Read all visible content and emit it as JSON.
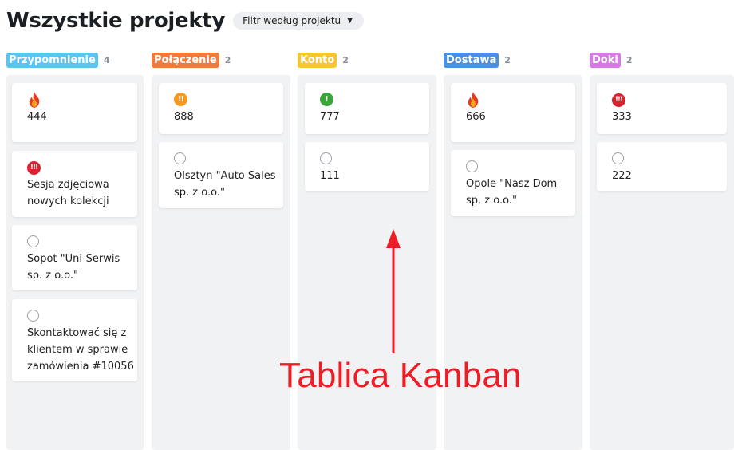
{
  "header": {
    "title": "Wszystkie projekty",
    "filter_label": "Filtr według projektu",
    "filter_caret": "▼"
  },
  "columns": [
    {
      "name": "Przypomnienie",
      "count": "4",
      "color": "#5bc5ef",
      "cards": [
        {
          "icon": "fire-icon",
          "text": "444"
        },
        {
          "icon": "priority-high-icon",
          "text": "Sesja zdjęciowa nowych kolekcji"
        },
        {
          "icon": "circle-icon",
          "text": "Sopot \"Uni-Serwis sp. z o.o.\""
        },
        {
          "icon": "circle-icon",
          "text": "Skontaktować się z klientem w sprawie zamówienia #10056"
        }
      ]
    },
    {
      "name": "Połączenie",
      "count": "2",
      "color": "#f07b3f",
      "cards": [
        {
          "icon": "priority-medium-icon",
          "text": "888"
        },
        {
          "icon": "circle-icon",
          "text": "Olsztyn \"Auto Sales sp. z o.o.\""
        }
      ]
    },
    {
      "name": "Konto",
      "count": "2",
      "color": "#f7c531",
      "cards": [
        {
          "icon": "priority-low-icon",
          "text": "777"
        },
        {
          "icon": "circle-icon",
          "text": "111"
        }
      ]
    },
    {
      "name": "Dostawa",
      "count": "2",
      "color": "#4a90e2",
      "cards": [
        {
          "icon": "fire-icon",
          "text": "666"
        },
        {
          "icon": "circle-icon",
          "text": "Opole \"Nasz Dom sp. z o.o.\""
        }
      ]
    },
    {
      "name": "Doki",
      "count": "2",
      "color": "#d77ae6",
      "cards": [
        {
          "icon": "priority-high-icon",
          "text": "333"
        },
        {
          "icon": "circle-icon",
          "text": "222"
        }
      ]
    }
  ],
  "badges": {
    "priority_high": "!!!",
    "priority_medium": "!!",
    "priority_low": "!"
  },
  "annotation": {
    "text": "Tablica Kanban",
    "color": "#ee1c24"
  }
}
